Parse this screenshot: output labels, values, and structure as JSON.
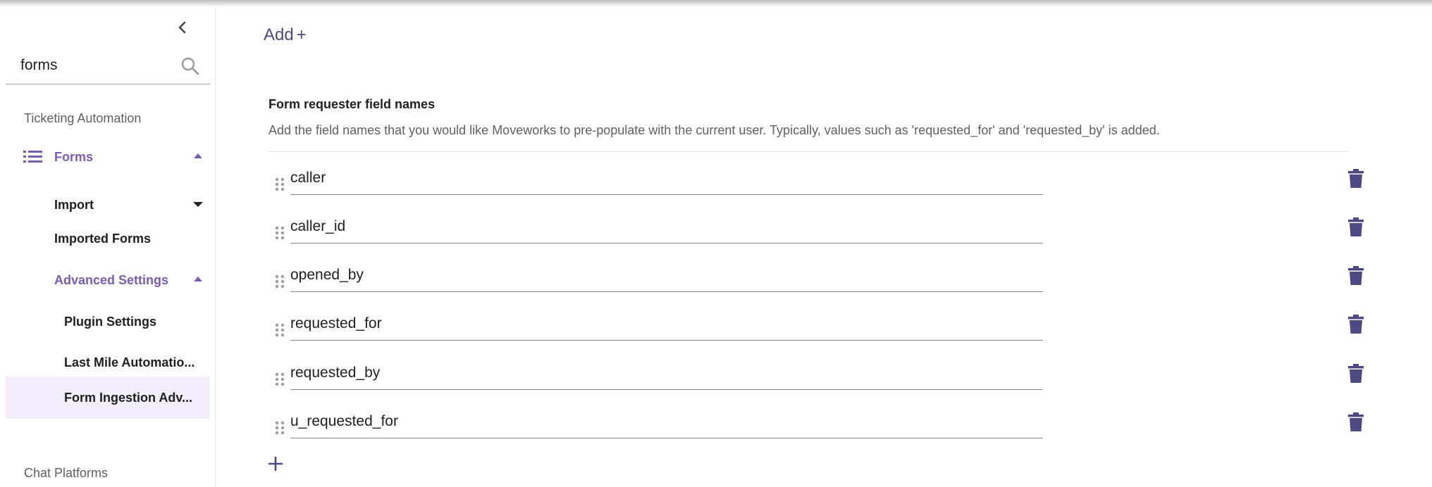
{
  "sidebar": {
    "search": {
      "value": "forms",
      "placeholder": ""
    },
    "sections": {
      "ticketing": "Ticketing Automation",
      "chat": "Chat Platforms"
    },
    "nav": {
      "forms": "Forms",
      "import": "Import",
      "imported_forms": "Imported Forms",
      "advanced_settings": "Advanced Settings",
      "plugin_settings": "Plugin Settings",
      "last_mile": "Last Mile Automatio...",
      "form_ingestion": "Form Ingestion Adv..."
    },
    "icons": {
      "collapse": "chevron-left-icon",
      "search": "search-icon",
      "forms": "list-icon"
    }
  },
  "main": {
    "add_label": "Add",
    "add_symbol": "+",
    "title": "Form requester field names",
    "description": "Add the field names that you would like Moveworks to pre-populate with the current user. Typically, values such as 'requested_for' and 'requested_by' is added.",
    "fields": [
      "caller",
      "caller_id",
      "opened_by",
      "requested_for",
      "requested_by",
      "u_requested_for"
    ]
  },
  "colors": {
    "accent": "#7b5cb0",
    "button": "#4b4a82",
    "selected_bg": "#f3ecfa"
  }
}
